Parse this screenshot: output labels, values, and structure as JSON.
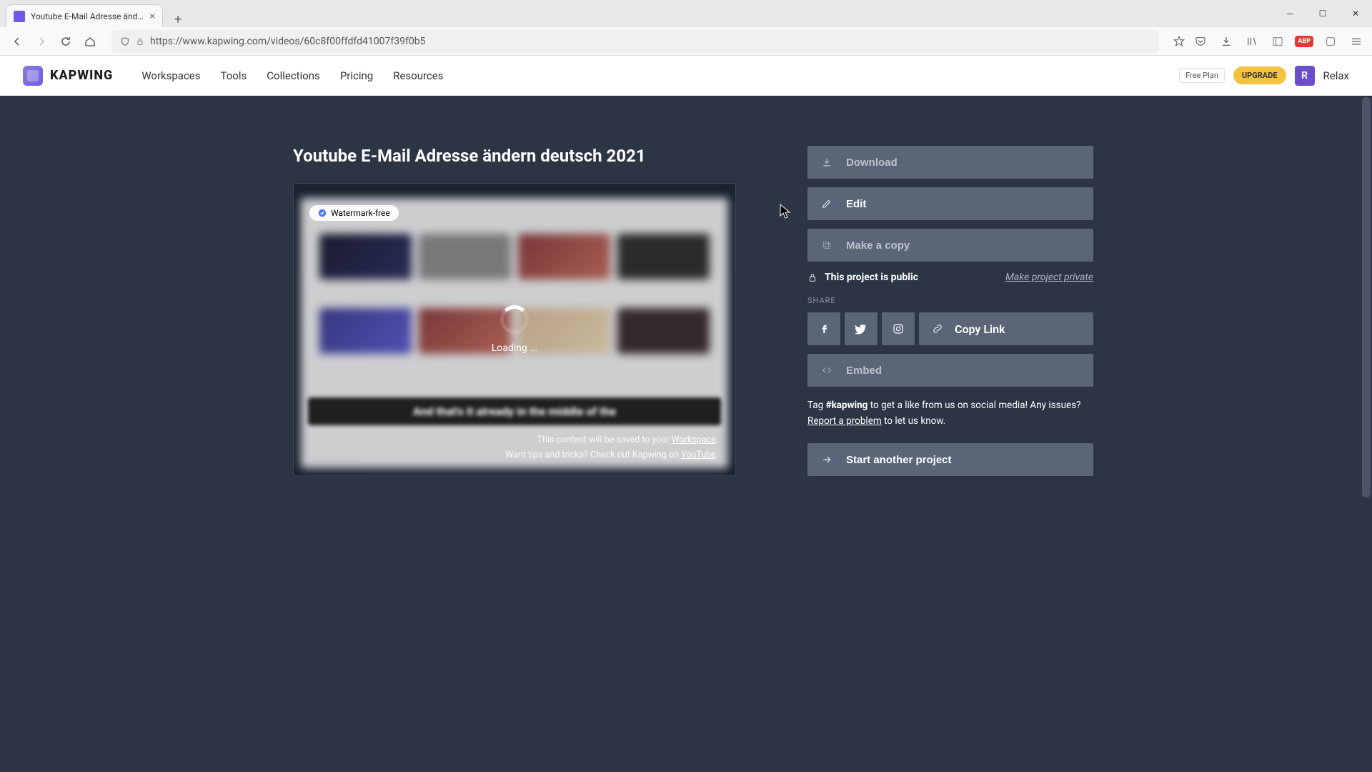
{
  "browser": {
    "tab_title": "Youtube E-Mail Adresse ändern",
    "url": "https://www.kapwing.com/videos/60c8f00ffdfd41007f39f0b5"
  },
  "header": {
    "logo_text": "KAPWING",
    "nav": [
      "Workspaces",
      "Tools",
      "Collections",
      "Pricing",
      "Resources"
    ],
    "plan": "Free Plan",
    "upgrade": "UPGRADE",
    "avatar_initial": "R",
    "username": "Relax"
  },
  "page": {
    "title": "Youtube E-Mail Adresse ändern deutsch 2021",
    "watermark_label": "Watermark-free",
    "loading": "Loading ...",
    "hint_line1_prefix": "This content will be saved to your ",
    "hint_line1_link": "Workspace",
    "hint_line2_prefix": "Want tips and tricks? Check out Kapwing on ",
    "hint_line2_link": "YouTube",
    "caption_blur": "And that's it already in the middle of the"
  },
  "actions": {
    "download": "Download",
    "edit": "Edit",
    "make_copy": "Make a copy",
    "visibility": "This project is public",
    "make_private": "Make project private",
    "share_label": "SHARE",
    "copy_link": "Copy Link",
    "embed": "Embed",
    "tag_prefix": "Tag ",
    "tag_hashtag": "#kapwing",
    "tag_suffix1": " to get a like from us on social media! Any issues? ",
    "report": "Report a problem",
    "tag_suffix2": " to let us know.",
    "start_another": "Start another project"
  }
}
